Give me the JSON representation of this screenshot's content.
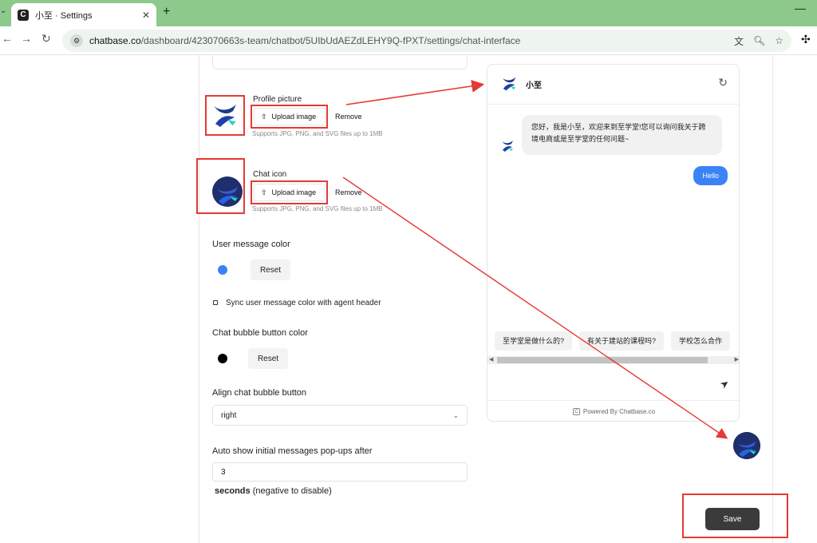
{
  "browser": {
    "tab_title": "小至 · Settings",
    "favicon_letter": "C",
    "new_tab_glyph": "+",
    "close_glyph": "✕",
    "url_host": "chatbase.co",
    "url_path": "/dashboard/423070663s-team/chatbot/5UIbUdAEZdLEHY9Q-fPXT/settings/chat-interface"
  },
  "settings": {
    "profile_picture": {
      "label": "Profile picture",
      "upload_label": "Upload image",
      "remove_label": "Remove",
      "hint": "Supports JPG, PNG, and SVG files up to 1MB"
    },
    "chat_icon": {
      "label": "Chat icon",
      "upload_label": "Upload image",
      "remove_label": "Remove",
      "hint": "Supports JPG, PNG, and SVG files up to 1MB"
    },
    "user_message_color": {
      "title": "User message color",
      "color": "#3b82f6",
      "reset_label": "Reset",
      "sync_label": "Sync user message color with agent header"
    },
    "chat_bubble_color": {
      "title": "Chat bubble button color",
      "color": "#000000",
      "reset_label": "Reset"
    },
    "align_bubble": {
      "title": "Align chat bubble button",
      "value": "right"
    },
    "auto_show": {
      "title": "Auto show initial messages pop-ups after",
      "value": "3",
      "unit_bold": "seconds",
      "unit_rest": " (negative to disable)"
    },
    "save_label": "Save"
  },
  "preview": {
    "bot_name": "小至",
    "bot_message": "您好，我是小至，欢迎来到至学堂!您可以询问我关于跨境电商或是至学堂的任何问题~",
    "user_message": "Hello",
    "suggestions": [
      "至学堂是做什么的?",
      "有关于建站的课程吗?",
      "学校怎么合作"
    ],
    "powered_by": "Powered By Chatbase.co",
    "user_bubble_color": "#3b82f6"
  },
  "annotations": {
    "color": "#e53935"
  }
}
